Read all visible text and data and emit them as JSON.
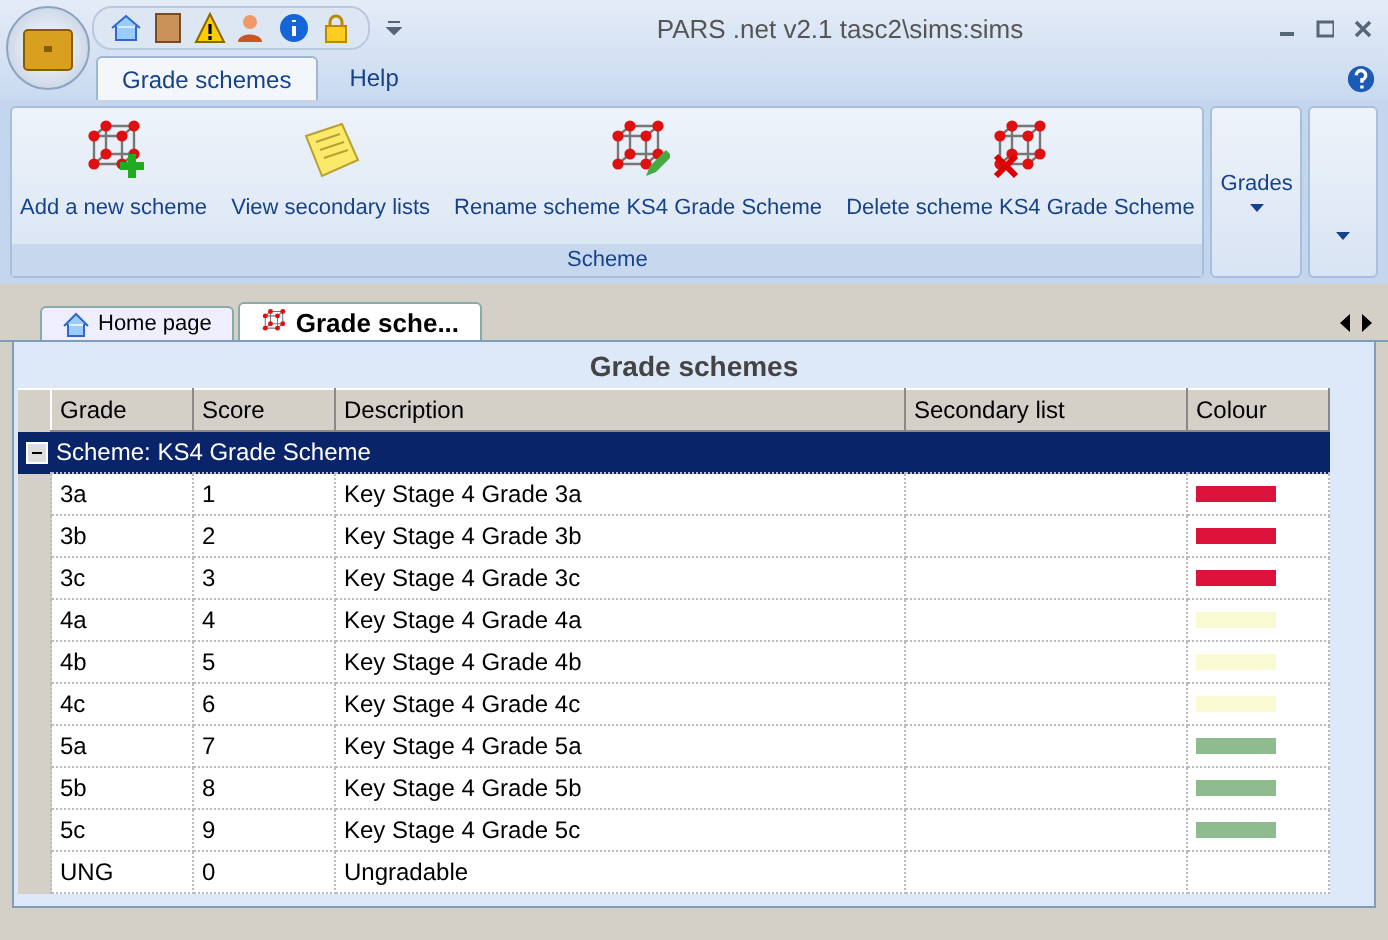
{
  "window": {
    "title": "PARS .net v2.1  tasc2\\sims:sims"
  },
  "ribbon_tabs": [
    {
      "label": "Grade schemes",
      "selected": true
    },
    {
      "label": "Help",
      "selected": false
    }
  ],
  "ribbon": {
    "groups": [
      {
        "label": "Scheme",
        "buttons": [
          {
            "label": "Add a new scheme",
            "kind": "add"
          },
          {
            "label": "View secondary lists",
            "kind": "note"
          },
          {
            "label": "Rename scheme KS4 Grade Scheme",
            "kind": "rename"
          },
          {
            "label": "Delete scheme KS4 Grade Scheme",
            "kind": "delete"
          }
        ]
      }
    ],
    "dropdowns": [
      {
        "label": "Grades",
        "kind": "labelled"
      },
      {
        "kind": "plain"
      }
    ]
  },
  "doc_tabs": [
    {
      "label": "Home page",
      "kind": "home",
      "selected": false
    },
    {
      "label": "Grade sche...",
      "kind": "scheme",
      "selected": true
    }
  ],
  "panel": {
    "title": "Grade schemes",
    "columns": [
      "Grade",
      "Score",
      "Description",
      "Secondary list",
      "Colour"
    ],
    "group": {
      "label": "Scheme:  KS4 Grade Scheme",
      "expanded": true
    },
    "rows": [
      {
        "grade": "3a",
        "score": "1",
        "description": "Key Stage 4 Grade 3a",
        "color": "#dc143c"
      },
      {
        "grade": "3b",
        "score": "2",
        "description": "Key Stage 4 Grade 3b",
        "color": "#dc143c"
      },
      {
        "grade": "3c",
        "score": "3",
        "description": "Key Stage 4 Grade 3c",
        "color": "#dc143c"
      },
      {
        "grade": "4a",
        "score": "4",
        "description": "Key Stage 4 Grade 4a",
        "color": "#fafad2"
      },
      {
        "grade": "4b",
        "score": "5",
        "description": "Key Stage 4 Grade 4b",
        "color": "#fafad2"
      },
      {
        "grade": "4c",
        "score": "6",
        "description": "Key Stage 4 Grade 4c",
        "color": "#fafad2"
      },
      {
        "grade": "5a",
        "score": "7",
        "description": "Key Stage 4 Grade 5a",
        "color": "#8fbc8f"
      },
      {
        "grade": "5b",
        "score": "8",
        "description": "Key Stage 4 Grade 5b",
        "color": "#8fbc8f"
      },
      {
        "grade": "5c",
        "score": "9",
        "description": "Key Stage 4 Grade 5c",
        "color": "#8fbc8f"
      },
      {
        "grade": "UNG",
        "score": "0",
        "description": "Ungradable"
      }
    ]
  }
}
